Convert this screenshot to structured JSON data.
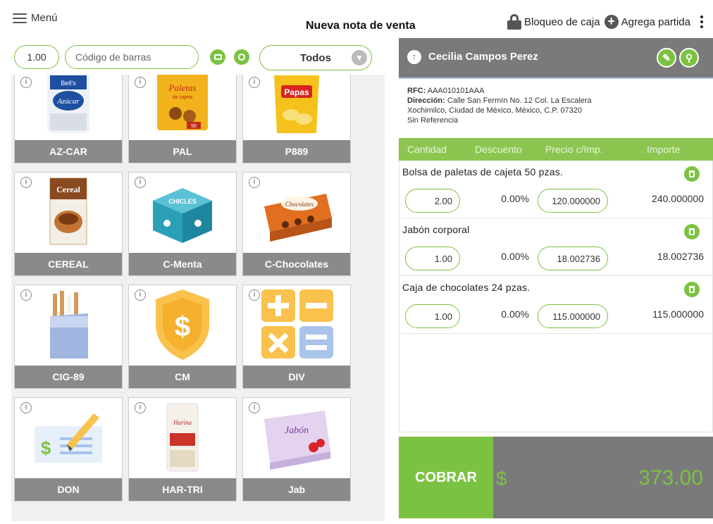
{
  "topbar": {
    "menu_label": "Menú",
    "title": "Nueva nota de venta",
    "lock_label": "Bloqueo de caja",
    "add_label": "Agrega partida"
  },
  "filters": {
    "quantity": "1.00",
    "barcode_placeholder": "Código de barras",
    "category": "Todos"
  },
  "products": [
    {
      "code": "AZ-CAR",
      "icon": "sugar-bag-icon"
    },
    {
      "code": "PAL",
      "icon": "lollipop-bag-icon"
    },
    {
      "code": "P889",
      "icon": "chips-bag-icon"
    },
    {
      "code": "CEREAL",
      "icon": "cereal-box-icon"
    },
    {
      "code": "C-Menta",
      "icon": "gum-box-icon"
    },
    {
      "code": "C-Chocolates",
      "icon": "chocolate-box-icon"
    },
    {
      "code": "CIG-89",
      "icon": "cigarette-pack-icon"
    },
    {
      "code": "CM",
      "icon": "dollar-shield-icon"
    },
    {
      "code": "DIV",
      "icon": "calculator-icon"
    },
    {
      "code": "DON",
      "icon": "check-pen-icon"
    },
    {
      "code": "HAR-TRI",
      "icon": "flour-bag-icon"
    },
    {
      "code": "Jab",
      "icon": "soap-box-icon"
    }
  ],
  "product_art": {
    "sugar_brand": "Bell's",
    "sugar_text": "Azúcar",
    "pal_text": "Paletas",
    "pal_sub": "de cajeta",
    "pal_badge": "50",
    "chips_text": "Papas",
    "cereal_text": "Cereal",
    "gum_text": "CHICLES",
    "choco_text": "Chocolates",
    "flour_text": "Harina",
    "soap_text": "Jabón"
  },
  "customer": {
    "name": "Cecilia Campos Perez",
    "rfc_label": "RFC:",
    "rfc": "AAA010101AAA",
    "address_label": "Dirección:",
    "address_line1": "Calle San Fermín No. 12 Col. La Escalera",
    "address_line2": "Xochimilco, Ciudad de México, México, C.P. 07320",
    "reference": "Sin Referencia"
  },
  "columns": {
    "qty": "Cantidad",
    "discount": "Descuento",
    "price": "Precio c/Imp.",
    "amount": "Importe"
  },
  "lines": [
    {
      "desc": "Bolsa de paletas de cajeta 50 pzas.",
      "qty": "2.00",
      "discount": "0.00%",
      "price": "120.000000",
      "amount": "240.000000"
    },
    {
      "desc": "Jabón corporal",
      "qty": "1.00",
      "discount": "0.00%",
      "price": "18.002736",
      "amount": "18.002736"
    },
    {
      "desc": "Caja de chocolates 24 pzas.",
      "qty": "1.00",
      "discount": "0.00%",
      "price": "115.000000",
      "amount": "115.000000"
    }
  ],
  "footer": {
    "cobrar_label": "COBRAR",
    "currency": "$",
    "total": "373.00"
  },
  "colors": {
    "accent_green": "#7cc242",
    "header_grey": "#7a7a7a",
    "column_green": "#8cc54f"
  }
}
